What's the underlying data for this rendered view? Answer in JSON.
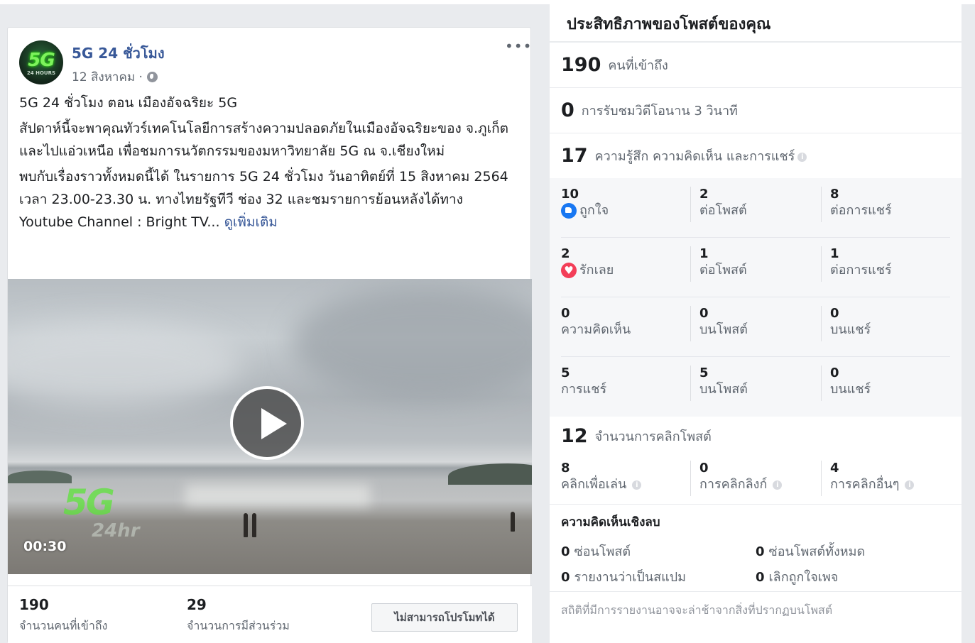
{
  "post": {
    "page_name": "5G 24 ชั่วโมง",
    "date": "12 สิงหาคม ·",
    "avatar_text": "5G",
    "avatar_subtext": "24 HOURS",
    "headline": "5G 24 ชั่วโมง ตอน เมืองอัจฉริยะ 5G",
    "paragraph1": "สัปดาห์นี้จะพาคุณทัวร์เทคโนโลยีการสร้างความปลอดภัยในเมืองอัจฉริยะของ จ.ภูเก็ต และไปแอ่วเหนือ เพื่อชมการนวัตกรรมของมหาวิทยาลัย 5G ณ จ.เชียงใหม่",
    "paragraph2": "พบกับเรื่องราวทั้งหมดนี้ได้ ในรายการ 5G 24 ชั่วโมง วันอาทิตย์ที่ 15 สิงหาคม 2564 เวลา 23.00-23.30 น. ทางไทยรัฐทีวี ช่อง 32 และชมรายการย้อนหลังได้ทาง Youtube Channel : Bright TV...",
    "see_more": "ดูเพิ่มเติม",
    "video": {
      "duration": "00:30",
      "watermark_main": "5G",
      "watermark_sub": "24hr"
    },
    "footer": {
      "reach_value": "190",
      "reach_label": "จำนวนคนที่เข้าถึง",
      "engagement_value": "29",
      "engagement_label": "จำนวนการมีส่วนร่วม",
      "promote_button": "ไม่สามารถโปรโมทได้"
    }
  },
  "insights": {
    "title": "ประสิทธิภาพของโพสต์ของคุณ",
    "reach": {
      "value": "190",
      "label": "คนที่เข้าถึง"
    },
    "video_views": {
      "value": "0",
      "label": "การรับชมวิดีโอนาน 3 วินาที"
    },
    "engagements": {
      "value": "17",
      "label": "ความรู้สึก ความคิดเห็น และการแชร์"
    },
    "breakdown": [
      {
        "value": "10",
        "label": "ถูกใจ",
        "icon": "like-icon",
        "on_post_value": "2",
        "on_post_label": "ต่อโพสต์",
        "on_share_value": "8",
        "on_share_label": "ต่อการแชร์"
      },
      {
        "value": "2",
        "label": "รักเลย",
        "icon": "love-icon",
        "on_post_value": "1",
        "on_post_label": "ต่อโพสต์",
        "on_share_value": "1",
        "on_share_label": "ต่อการแชร์"
      },
      {
        "value": "0",
        "label": "ความคิดเห็น",
        "on_post_value": "0",
        "on_post_label": "บนโพสต์",
        "on_share_value": "0",
        "on_share_label": "บนแชร์"
      },
      {
        "value": "5",
        "label": "การแชร์",
        "on_post_value": "5",
        "on_post_label": "บนโพสต์",
        "on_share_value": "0",
        "on_share_label": "บนแชร์"
      }
    ],
    "post_clicks": {
      "value": "12",
      "label": "จำนวนการคลิกโพสต์",
      "items": [
        {
          "value": "8",
          "label": "คลิกเพื่อเล่น"
        },
        {
          "value": "0",
          "label": "การคลิกลิงก์"
        },
        {
          "value": "4",
          "label": "การคลิกอื่นๆ"
        }
      ]
    },
    "negative": {
      "title": "ความคิดเห็นเชิงลบ",
      "hide_post": {
        "value": "0",
        "label": "ซ่อนโพสต์"
      },
      "hide_all": {
        "value": "0",
        "label": "ซ่อนโพสต์ทั้งหมด"
      },
      "report_spam": {
        "value": "0",
        "label": "รายงานว่าเป็นสแปม"
      },
      "unlike_page": {
        "value": "0",
        "label": "เลิกถูกใจเพจ"
      }
    },
    "note": "สถิติที่มีการรายงานอาจจะล่าช้าจากสิ่งที่ปรากฏบนโพสต์"
  },
  "colors": {
    "link_blue": "#385898",
    "like_blue": "#1877f2",
    "love_red": "#f33e58",
    "page_bg": "#e9ebee"
  }
}
